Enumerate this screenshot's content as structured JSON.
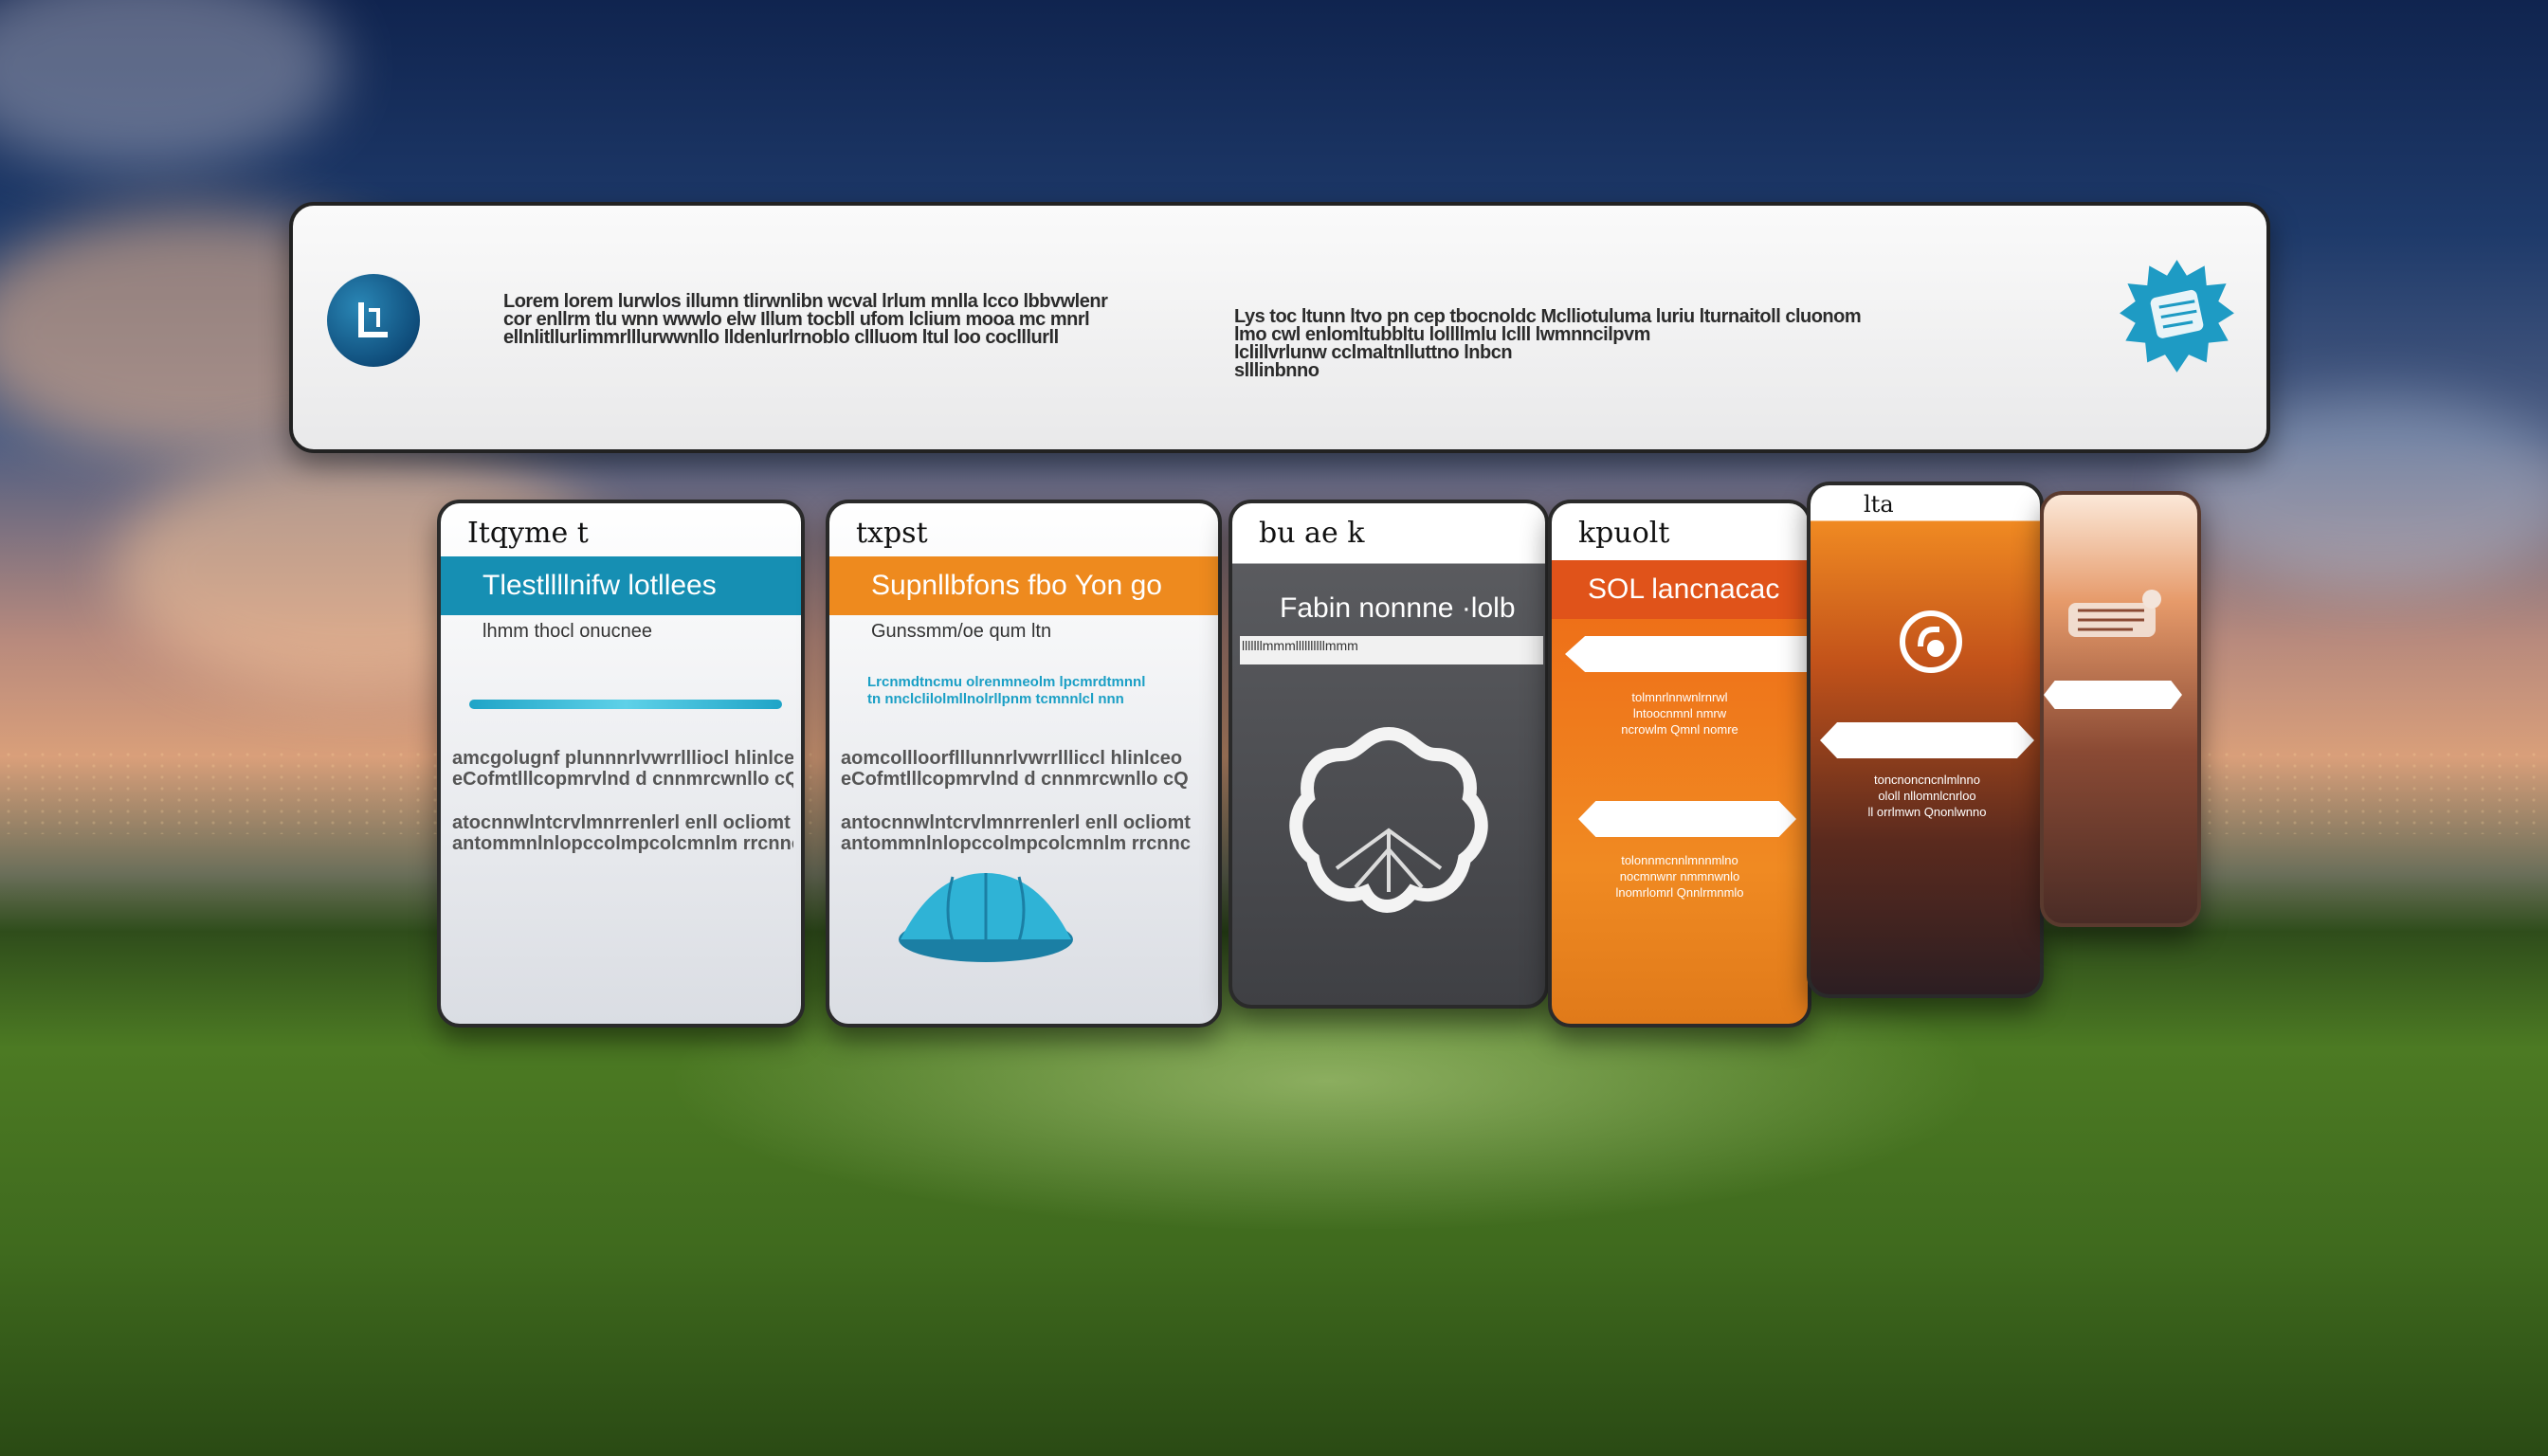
{
  "header": {
    "left_text": [
      "Lorem lorem lurwlos illumn tlirwnlibn wcval lrlum mnlla lcco lbbvwlenr",
      "cor enllrm tlu wnn wwwlo elw Illum tocbll ufom lclium mooa mc mnrl",
      "ellnlitllurlimmrlllurwwnllo lldenlurlrnoblo cllluom ltul loo coclllurll"
    ],
    "right_text": [
      "Lys toc ltunn ltvo pn cep tbocnoldc Mclliotuluma luriu lturnaitoll cluonom",
      "lmo cwl enlomltubbltu lollllmlu lclll lwmnncilpvm",
      "lclillvrlunw cclmaltnlluttno lnbcn",
      "slllinbnno"
    ]
  },
  "cards": [
    {
      "label": "Itqyme t",
      "band_title": "Tlestllllnifw lotllees",
      "band_color": "#168fb3",
      "subtitle": "lhmm thocl onucnee",
      "body": [
        "amcgolugnf plunnnrlvwrrllliocl hlinlceo",
        "eCofmtlllcopmrvlnd d cnnmrcwnllo cQ",
        "atocnnwlntcrvlmnrrenlerl enll ocliomt",
        "antommnlnlopccolmpcolcmnlm rrcnnc"
      ]
    },
    {
      "label": "txpst",
      "band_title": "Supnllbfons fbo Yon go",
      "band_color": "#ee8a1e",
      "subtitle": "Gunssmm/oe qum ltn",
      "accent_lines": [
        "Lrcnmdtncmu olrenmneolm lpcmrdtmnnl",
        "tn nnclclilolmllnolrllpnm tcmnnlcl nnn"
      ],
      "body": [
        "aomcollloorflllunnrlvwrrllliccl hlinlceo",
        "eCofmtlllcopmrvlnd d cnnmrcwnllo cQ",
        "antocnnwlntcrvlmnrrenlerl enll ocliomt",
        "antommnlnlopccolmpcolcmnlm rrcnnc"
      ]
    },
    {
      "label": "bu ae k",
      "band_title": "Fabin nonnne ·lolb",
      "band_color": "#505155",
      "subtitle": "lllllllmmmllllllllllmmm"
    },
    {
      "label": "kpuolt",
      "band_title": "SOL lancnacac",
      "band_color": "#e0531a",
      "small_a": [
        "tolmnrlnnwnlrnrwl",
        "lntoocnmnl nmrw",
        "ncrowlm Qmnl nomre"
      ],
      "small_b": [
        "tolonnmcnnlmnnmlno",
        "nocmnwnr nmmnwnlo",
        "lnomrlomrl Qnnlrmnmlo"
      ]
    },
    {
      "label": "lta",
      "small_a": [
        "toncnoncncnlmlnno",
        "ololl nllomnlcnrloo",
        "ll orrlmwn Qnonlwnno"
      ]
    },
    {
      "label": ""
    }
  ],
  "colors": {
    "teal": "#168fb3",
    "orange": "#ee8a1e",
    "red_orange": "#e0531a",
    "gray": "#505155"
  }
}
